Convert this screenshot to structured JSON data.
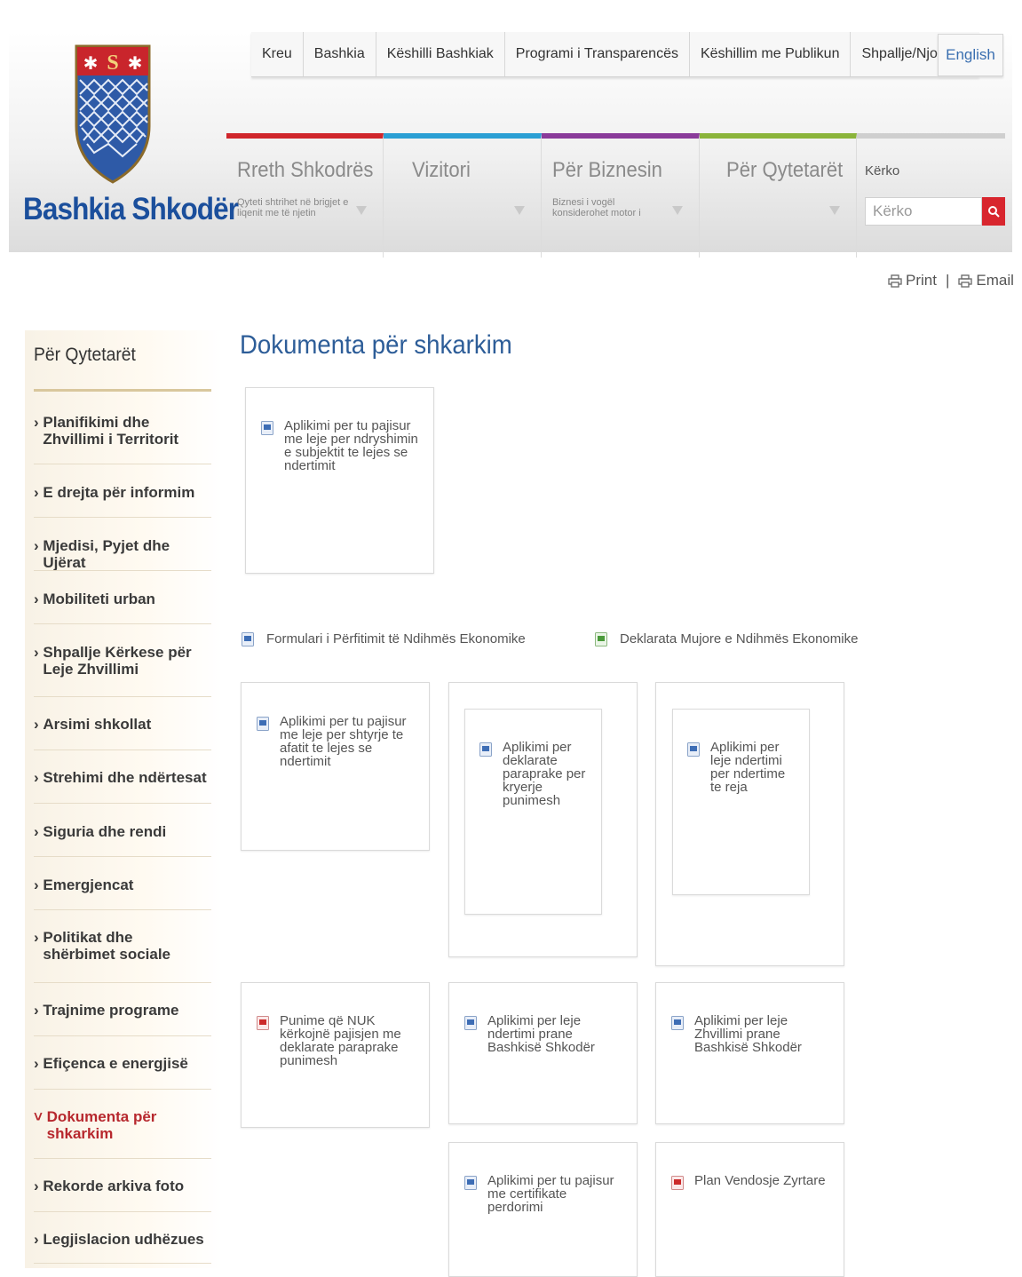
{
  "header": {
    "logo_text": "Bashkia Shkodër",
    "top_menu": [
      "Kreu",
      "Bashkia",
      "Këshilli Bashkiak",
      "Programi i Transparencës",
      "Këshillim me Publikun",
      "Shpallje/Njoftime"
    ],
    "english_label": "English",
    "nav": [
      {
        "title": "Rreth Shkodrës",
        "subtitle": "Qyteti shtrihet në brigjet e liqenit me të njetin",
        "color": "#d0262c"
      },
      {
        "title": "Vizitori",
        "subtitle": "",
        "color": "#2b9fd4"
      },
      {
        "title": "Për Biznesin",
        "subtitle": "Biznesi i vogël konsiderohet motor i",
        "color": "#8a3b9a"
      },
      {
        "title": "Për Qytetarët",
        "subtitle": "",
        "color": "#8bb43b"
      }
    ],
    "search": {
      "label": "Kërko",
      "placeholder": "Kërko",
      "button_color": "#d8262e"
    }
  },
  "utils": {
    "print": "Print",
    "separator": "|",
    "email": "Email"
  },
  "sidebar": {
    "title": "Për Qytetarët",
    "items": [
      "Planifikimi dhe Zhvillimi i Territorit",
      "E drejta për informim",
      "Mjedisi, Pyjet dhe Ujërat",
      "Mobiliteti urban",
      "Shpallje Kërkese për Leje Zhvillimi",
      "Arsimi shkollat",
      "Strehimi dhe ndërtesat",
      "Siguria dhe rendi",
      "Emergjencat",
      "Politikat dhe shërbimet sociale",
      "Trajnime programe",
      "Efiçenca e energjisë",
      "Dokumenta për shkarkim",
      "Rekorde arkiva foto",
      "Legjislacion udhëzues"
    ],
    "active_index": 12
  },
  "main": {
    "title": "Dokumenta për shkarkim",
    "documents": {
      "doc1": "Aplikimi per tu pajisur me leje per ndryshimin e subjektit te lejes se ndertimit",
      "link1": "Formulari i Përfitimit të Ndihmës Ekonomike",
      "link2": "Deklarata Mujore e Ndihmës Ekonomike",
      "doc2": "Aplikimi per tu pajisur me leje per shtyrje te afatit te lejes se ndertimit",
      "doc3": "Aplikimi per deklarate paraprake per kryerje punimesh",
      "doc4": "Aplikimi per leje ndertimi per ndertime te reja",
      "doc5": "Punime që NUK kërkojnë pajisjen me deklarate paraprake punimesh",
      "doc6": "Aplikimi per leje ndertimi prane Bashkisë Shkodër",
      "doc7": "Aplikimi per leje Zhvillimi prane Bashkisë Shkodër",
      "doc8": "Aplikimi per tu pajisur me certifikate perdorimi",
      "doc9": "Plan Vendosje Zyrtare"
    },
    "icon_types": {
      "doc1": "word-doc-icon",
      "link1": "word-doc-icon",
      "link2": "excel-doc-icon",
      "doc2": "word-doc-icon",
      "doc3": "word-doc-icon",
      "doc4": "word-doc-icon",
      "doc5": "pdf-doc-icon",
      "doc6": "word-doc-icon",
      "doc7": "word-doc-icon",
      "doc8": "word-doc-icon",
      "doc9": "pdf-doc-icon"
    }
  }
}
